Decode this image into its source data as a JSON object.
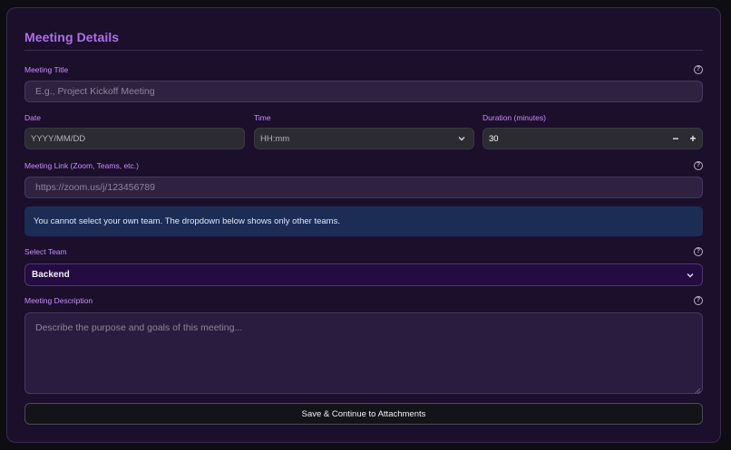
{
  "section": {
    "title": "Meeting Details"
  },
  "title_field": {
    "label": "Meeting Title",
    "placeholder": "E.g., Project Kickoff Meeting"
  },
  "date_field": {
    "label": "Date",
    "placeholder": "YYYY/MM/DD"
  },
  "time_field": {
    "label": "Time",
    "placeholder": "HH:mm"
  },
  "duration_field": {
    "label": "Duration (minutes)",
    "value": "30",
    "minus": "−",
    "plus": "+"
  },
  "link_field": {
    "label": "Meeting Link (Zoom, Teams, etc.)",
    "placeholder": "https://zoom.us/j/123456789"
  },
  "info_message": "You cannot select your own team. The dropdown below shows only other teams.",
  "team_select": {
    "label": "Select Team",
    "value": "Backend"
  },
  "description_field": {
    "label": "Meeting Description",
    "placeholder": "Describe the purpose and goals of this meeting..."
  },
  "save_button": {
    "label": "Save & Continue to Attachments"
  },
  "help_glyph": "?",
  "colors": {
    "accent": "#b06ee8",
    "label": "#c98cff",
    "panel": "#1b0f2c",
    "info_bg": "#1c2d55"
  },
  "icons": {
    "help": "help-circle-icon",
    "chevron": "chevron-down-icon"
  }
}
